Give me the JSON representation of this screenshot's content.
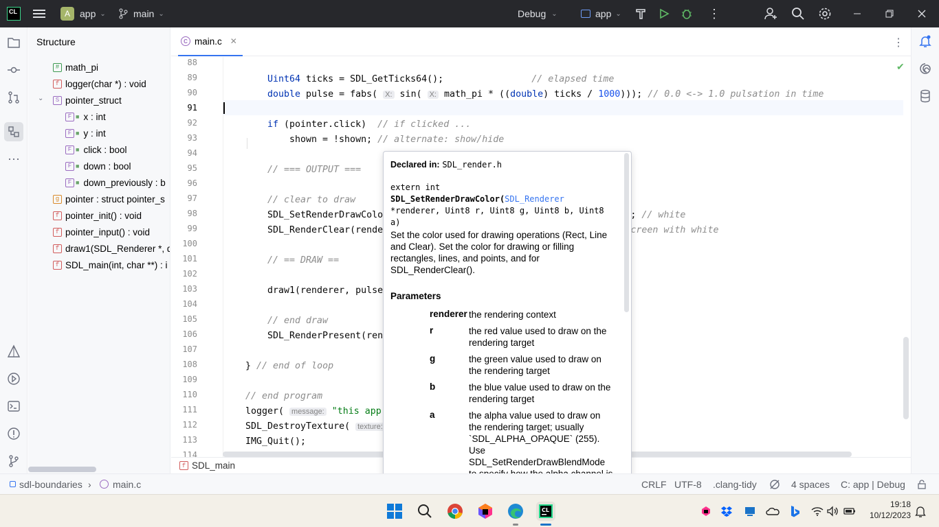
{
  "titlebar": {
    "project_letter": "A",
    "project": "app",
    "branch": "main",
    "run_config": "Debug",
    "target": "app"
  },
  "structure": {
    "title": "Structure",
    "items": [
      {
        "tag": "#",
        "kind": "h",
        "label": "math_pi"
      },
      {
        "tag": "f",
        "kind": "f",
        "label": "logger(char *) : void"
      },
      {
        "tag": "S",
        "kind": "S",
        "label": "pointer_struct"
      },
      {
        "tag": "F",
        "kind": "F",
        "label": "x : int"
      },
      {
        "tag": "F",
        "kind": "F",
        "label": "y : int"
      },
      {
        "tag": "F",
        "kind": "F",
        "label": "click : bool"
      },
      {
        "tag": "F",
        "kind": "F",
        "label": "down : bool"
      },
      {
        "tag": "F",
        "kind": "F",
        "label": "down_previously : b"
      },
      {
        "tag": "g",
        "kind": "g",
        "label": "pointer : struct pointer_s"
      },
      {
        "tag": "f",
        "kind": "f",
        "label": "pointer_init() : void"
      },
      {
        "tag": "f",
        "kind": "f",
        "label": "pointer_input() : void"
      },
      {
        "tag": "f",
        "kind": "f",
        "label": "draw1(SDL_Renderer *, d"
      },
      {
        "tag": "f",
        "kind": "f",
        "label": "SDL_main(int, char **) : i"
      }
    ]
  },
  "editor": {
    "tab": "main.c",
    "breadcrumb_fn": "SDL_main",
    "line_numbers": [
      "88",
      "89",
      "90",
      "91",
      "92",
      "93",
      "94",
      "95",
      "96",
      "97",
      "98",
      "99",
      "100",
      "101",
      "102",
      "103",
      "104",
      "105",
      "106",
      "107",
      "108",
      "109",
      "110",
      "111",
      "112",
      "113",
      "114"
    ]
  },
  "popup": {
    "declared_label": "Declared in:",
    "declared_file": "SDL_render.h",
    "sig1": "extern int",
    "sig_name": "SDL_SetRenderDrawColor(",
    "sig_type": "SDL_Renderer",
    "sig3": "*renderer, Uint8 r, Uint8 g, Uint8 b, Uint8",
    "sig4": "a)",
    "desc": "Set the color used for drawing operations (Rect, Line and Clear). Set the color for drawing or filling rectangles, lines, and points, and for SDL_RenderClear().",
    "params_title": "Parameters",
    "params": [
      {
        "name": "renderer",
        "desc": "the rendering context"
      },
      {
        "name": "r",
        "desc": "the red value used to draw on the rendering target"
      },
      {
        "name": "g",
        "desc": "the green value used to draw on the rendering target"
      },
      {
        "name": "b",
        "desc": "the blue value used to draw on the rendering target"
      },
      {
        "name": "a",
        "desc": "the alpha value used to draw on the rendering target; usually `SDL_ALPHA_OPAQUE` (255). Use SDL_SetRenderDrawBlendMode  to specify how the alpha channel is used"
      }
    ]
  },
  "statusbar": {
    "project": "sdl-boundaries",
    "file": "main.c",
    "line_sep": "CRLF",
    "encoding": "UTF-8",
    "linter": ".clang-tidy",
    "indent": "4 spaces",
    "context": "C: app | Debug"
  },
  "taskbar": {
    "time": "19:18",
    "date": "10/12/2023"
  }
}
